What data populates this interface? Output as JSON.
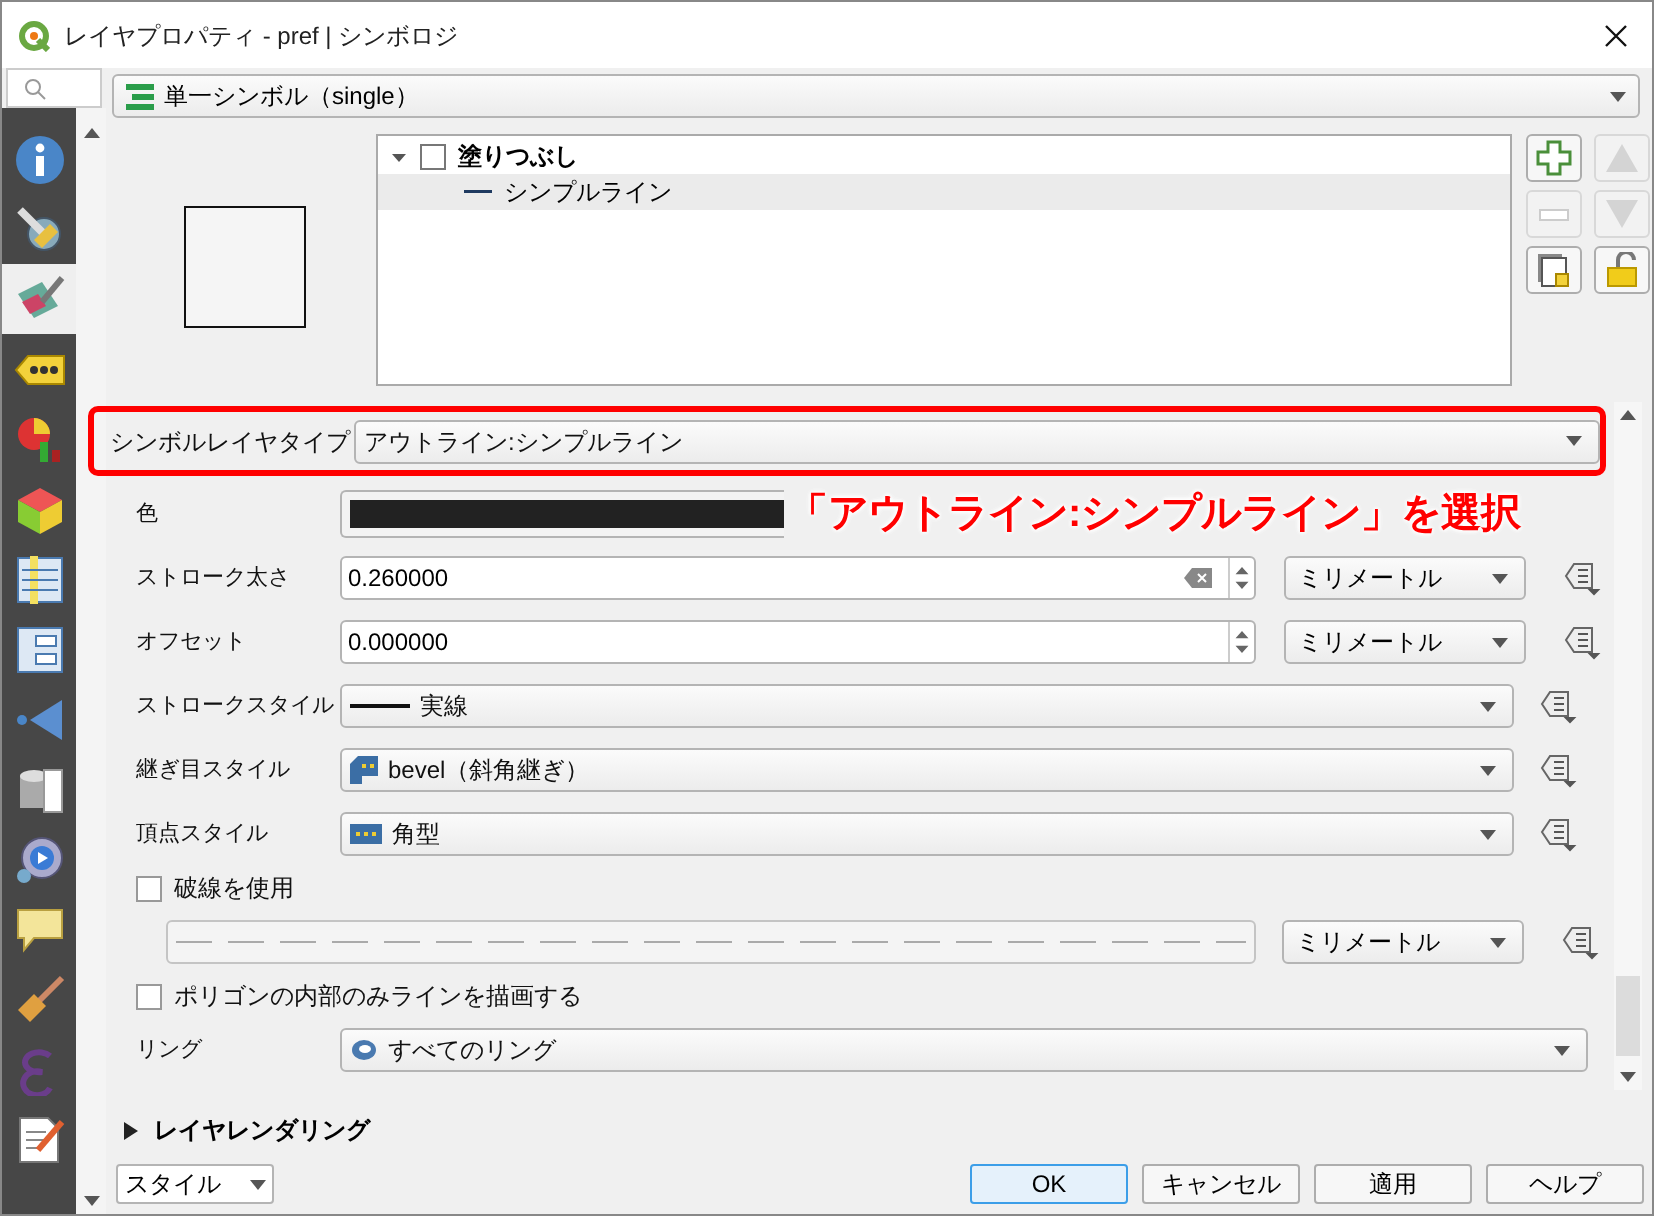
{
  "window": {
    "title": "レイヤプロパティ - pref | シンボロジ"
  },
  "sidebar": {
    "items": [
      {
        "selected": false
      },
      {
        "selected": false
      },
      {
        "selected": true
      },
      {
        "selected": false
      },
      {
        "selected": false
      },
      {
        "selected": false
      },
      {
        "selected": false
      },
      {
        "selected": false
      },
      {
        "selected": false
      },
      {
        "selected": false
      },
      {
        "selected": false
      },
      {
        "selected": false
      },
      {
        "selected": false
      },
      {
        "selected": false
      },
      {
        "selected": false
      }
    ]
  },
  "renderer": {
    "value": "単一シンボル（single）"
  },
  "symbol_tree": [
    {
      "label": "塗りつぶし",
      "expanded": true,
      "selected": false,
      "children": [
        {
          "label": "シンプルライン",
          "selected": true
        }
      ]
    }
  ],
  "layer_buttons": [
    {
      "kind": "add",
      "disabled": false
    },
    {
      "kind": "up",
      "disabled": true
    },
    {
      "kind": "remove",
      "disabled": true
    },
    {
      "kind": "down",
      "disabled": true
    },
    {
      "kind": "duplicate",
      "disabled": false
    },
    {
      "kind": "lock",
      "disabled": false
    }
  ],
  "symbol_layer_type": {
    "label": "シンボルレイヤタイプ",
    "value": "アウトライン:シンプルライン"
  },
  "annotation": "「アウトライン:シンプルライン」を選択",
  "properties": [
    {
      "kind": "color",
      "label": "色",
      "color": "#222222"
    },
    {
      "kind": "spin",
      "label": "ストローク太さ",
      "value": "0.260000",
      "clearable": true,
      "unit": "ミリメートル"
    },
    {
      "kind": "spin",
      "label": "オフセット",
      "value": "0.000000",
      "clearable": false,
      "unit": "ミリメートル"
    },
    {
      "kind": "combo",
      "label": "ストロークスタイル",
      "value": "実線"
    },
    {
      "kind": "combo",
      "label": "継ぎ目スタイル",
      "value": "bevel（斜角継ぎ）"
    },
    {
      "kind": "combo",
      "label": "頂点スタイル",
      "value": "角型"
    },
    {
      "kind": "checkbox",
      "label": "破線を使用",
      "checked": false
    },
    {
      "kind": "dash",
      "unit": "ミリメートル"
    },
    {
      "kind": "checkbox",
      "label": "ポリゴンの内部のみラインを描画する",
      "checked": false
    },
    {
      "kind": "ring",
      "label": "リング",
      "value": "すべてのリング"
    }
  ],
  "sections": [
    {
      "label": "レイヤレンダリング",
      "expanded": false
    }
  ],
  "footer": {
    "style_button": "スタイル",
    "buttons": [
      {
        "label": "OK",
        "default": true
      },
      {
        "label": "キャンセル",
        "default": false
      },
      {
        "label": "適用",
        "default": false
      },
      {
        "label": "ヘルプ",
        "default": false
      }
    ]
  }
}
